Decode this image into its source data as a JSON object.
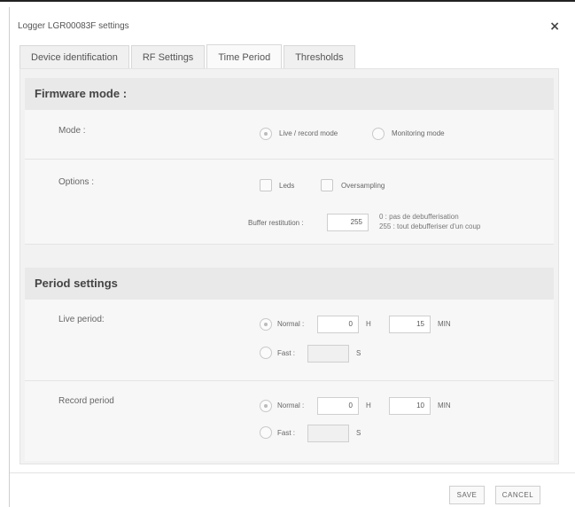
{
  "window": {
    "title": "Logger LGR00083F settings",
    "close_glyph": "×"
  },
  "tabs": [
    {
      "label": "Device identification",
      "active": false
    },
    {
      "label": "RF Settings",
      "active": false
    },
    {
      "label": "Time Period",
      "active": true
    },
    {
      "label": "Thresholds",
      "active": false
    }
  ],
  "firmware": {
    "header": "Firmware mode :",
    "mode_label": "Mode :",
    "mode_options": [
      {
        "label": "Live / record mode",
        "selected": true
      },
      {
        "label": "Monitoring mode",
        "selected": false
      }
    ],
    "options_label": "Options :",
    "checkboxes": [
      {
        "label": "Leds",
        "checked": false
      },
      {
        "label": "Oversampling",
        "checked": false
      }
    ],
    "buffer_label": "Buffer restitution :",
    "buffer_value": "255",
    "buffer_hint_1": "0 : pas de debufferisation",
    "buffer_hint_2": "255 : tout debufferiser d'un coup"
  },
  "period": {
    "header": "Period settings",
    "live": {
      "label": "Live period:",
      "normal_label": "Normal :",
      "hours": "0",
      "hours_unit": "H",
      "minutes": "15",
      "minutes_unit": "MIN",
      "fast_label": "Fast :",
      "fast_value": "",
      "fast_unit": "S",
      "normal_selected": true
    },
    "record": {
      "label": "Record period",
      "normal_label": "Normal :",
      "hours": "0",
      "hours_unit": "H",
      "minutes": "10",
      "minutes_unit": "MIN",
      "fast_label": "Fast :",
      "fast_value": "",
      "fast_unit": "S",
      "normal_selected": true
    }
  },
  "footer": {
    "save": "SAVE",
    "cancel": "CANCEL"
  }
}
